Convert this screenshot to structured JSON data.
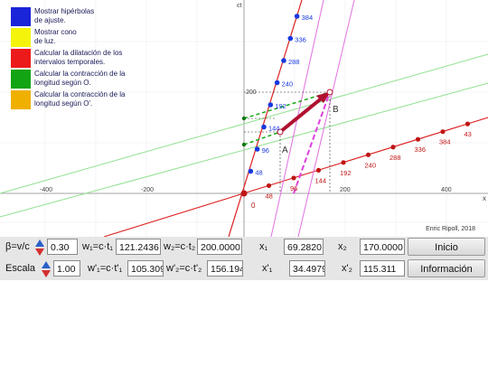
{
  "legend": [
    {
      "label": "Mostrar hipérbolas\nde ajuste.",
      "color": "#1a24d8"
    },
    {
      "label": "Mostrar cono\nde luz.",
      "color": "#f4f40a"
    },
    {
      "label": "Calcular la dilatación de los\nintervalos temporales.",
      "color": "#ec1a1a"
    },
    {
      "label": "Calcular la contracción de la\nlongitud según O.",
      "color": "#12a412"
    },
    {
      "label": "Calcular la contracción de la\nlongitud según O'.",
      "color": "#f0b000"
    }
  ],
  "credit": "Enric Ripoll, 2018",
  "graph": {
    "axis_x_label": "x",
    "axis_ct_label": "ct",
    "x_ticks": [
      "-400",
      "-200",
      "200",
      "400"
    ],
    "ct_tick": "200",
    "origin_label": "0",
    "point_A": "A",
    "point_B": "B",
    "ct_axis_labels": [
      "48",
      "96",
      "144",
      "192",
      "240",
      "288",
      "336",
      "384"
    ],
    "x_axis_labels": [
      "48",
      "96",
      "144",
      "192",
      "240",
      "288",
      "336",
      "384",
      "43"
    ],
    "colors": {
      "ct_axis": "#dd2020",
      "x_axis": "#c01515",
      "light": "#c8f0c8",
      "green": "#15aa15",
      "magenta": "#dd40dd",
      "arrow": "#b01030",
      "blue": "#1838e0",
      "grid": "#e6e6e6"
    }
  },
  "controls": {
    "row1": {
      "beta_label": "β=v/c",
      "beta_value": "0.30",
      "w1_label": "w₁=c·t₁",
      "w1_value": "121.2436",
      "w2_label": "w₂=c·t₂",
      "w2_value": "200.0000",
      "x1_label": "x₁",
      "x1_value": "69.2820",
      "x2_label": "x₂",
      "x2_value": "170.0000",
      "start_button": "Inicio"
    },
    "row2": {
      "scale_label": "Escala",
      "scale_value": "1.00",
      "w1p_label": "w'₁=c·t'₁",
      "w1p_value": "105.309",
      "w2p_label": "w'₂=c·t'₂",
      "w2p_value": "156.194",
      "x1p_label": "x'₁",
      "x1p_value": "34.4979",
      "x2p_label": "x'₂",
      "x2p_value": "115.311",
      "info_button": "Información"
    }
  }
}
